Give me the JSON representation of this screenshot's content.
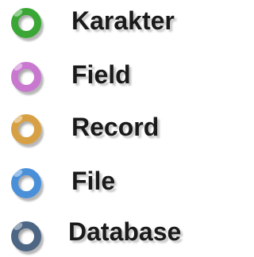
{
  "legend": {
    "items": [
      {
        "label": "Karakter",
        "color": "#3aa635"
      },
      {
        "label": "Field",
        "color": "#c978cf"
      },
      {
        "label": "Record",
        "color": "#d8a044"
      },
      {
        "label": "File",
        "color": "#4a90d9"
      },
      {
        "label": "Database",
        "color": "#4c6684"
      }
    ]
  }
}
